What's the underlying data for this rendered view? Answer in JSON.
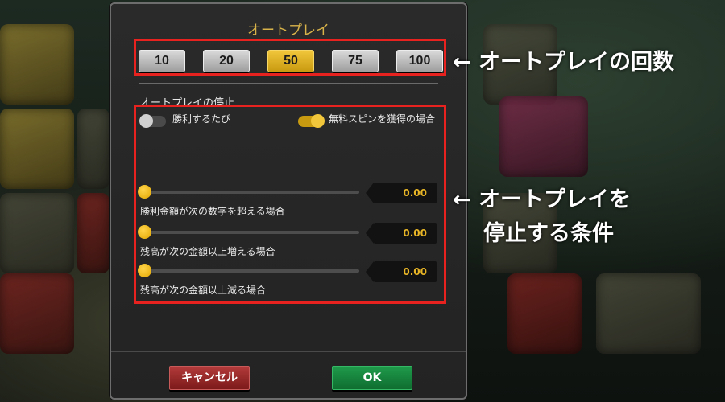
{
  "dialog": {
    "title": "オートプレイ",
    "rounds": [
      {
        "label": "10",
        "active": false
      },
      {
        "label": "20",
        "active": false
      },
      {
        "label": "50",
        "active": true
      },
      {
        "label": "75",
        "active": false
      },
      {
        "label": "100",
        "active": false
      }
    ],
    "stop_section_label": "オートプレイの停止",
    "toggles": [
      {
        "label": "勝利するたび",
        "state": "off"
      },
      {
        "label": "無料スピンを獲得の場合",
        "state": "on"
      }
    ],
    "conditions": [
      {
        "label": "勝利金額が次の数字を超える場合",
        "value": "0.00",
        "level": 0
      },
      {
        "label": "残高が次の金額以上増える場合",
        "value": "0.00",
        "level": 0
      },
      {
        "label": "残高が次の金額以上減る場合",
        "value": "0.00",
        "level": 0
      }
    ],
    "cancel_label": "キャンセル",
    "ok_label": "OK"
  },
  "annotations": {
    "rounds_note": "← オートプレイの回数",
    "stop_note_line1": "← オートプレイを",
    "stop_note_line2": "停止する条件"
  },
  "colors": {
    "accent_gold": "#d8b34a",
    "annotation_red": "#e8231f",
    "cancel_red": "#8c1f1f",
    "ok_green": "#138a3c"
  }
}
